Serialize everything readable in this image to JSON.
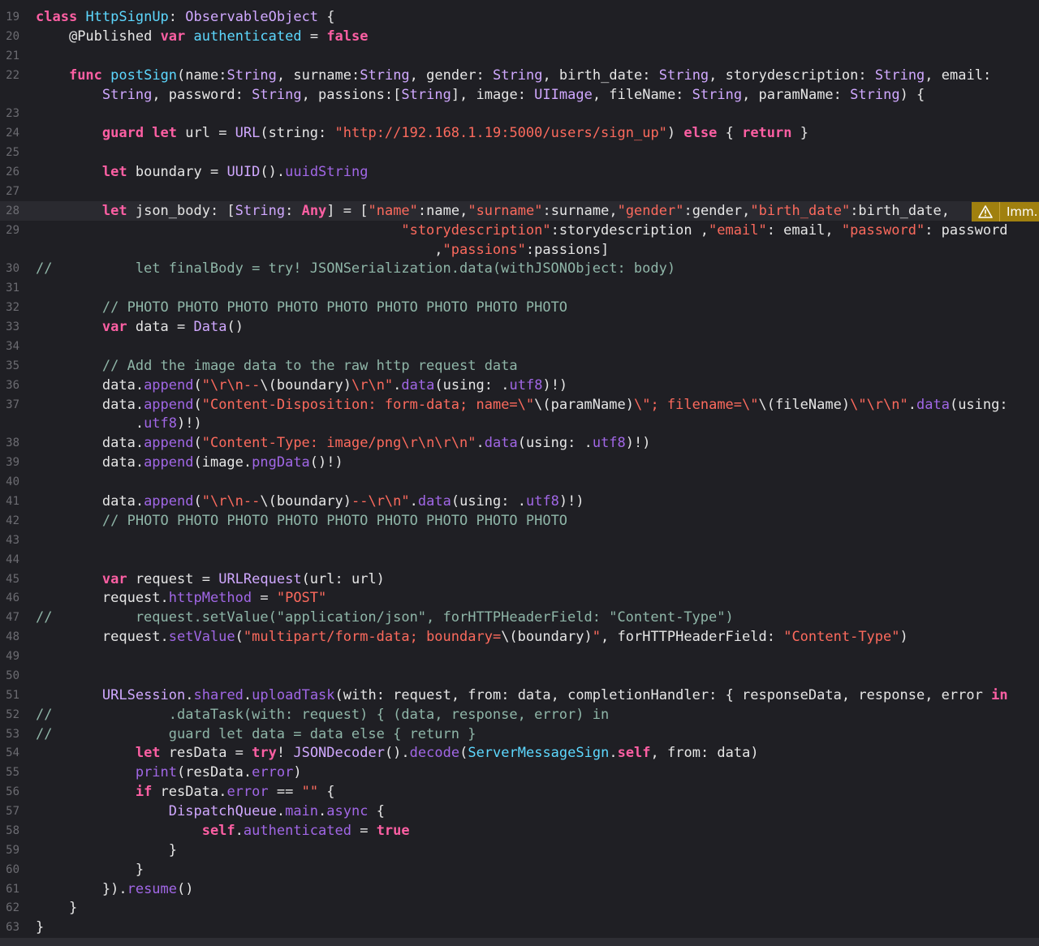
{
  "editor": {
    "warning_label": "Imm.",
    "warning_icon": "warning-triangle-icon",
    "lines": [
      {
        "n": "19",
        "html": "<span class=\"kw\">class</span> <span class=\"tn\">HttpSignUp</span>: <span class=\"ty\">ObservableObject</span> {"
      },
      {
        "n": "20",
        "html": "    <span class=\"pl\">@Published</span> <span class=\"kw\">var</span> <span class=\"tn\">authenticated</span> = <span class=\"kw\">false</span>"
      },
      {
        "n": "21",
        "html": ""
      },
      {
        "n": "22",
        "html": "    <span class=\"kw\">func</span> <span class=\"tn\">postSign</span>(name:<span class=\"ty\">String</span>, surname:<span class=\"ty\">String</span>, gender: <span class=\"ty\">String</span>, birth_date: <span class=\"ty\">String</span>, storydescription: <span class=\"ty\">String</span>, email:"
      },
      {
        "n": "",
        "html": "        <span class=\"ty\">String</span>, password: <span class=\"ty\">String</span>, passions:[<span class=\"ty\">String</span>], image: <span class=\"ty\">UIImage</span>, fileName: <span class=\"ty\">String</span>, paramName: <span class=\"ty\">String</span>) {"
      },
      {
        "n": "23",
        "html": ""
      },
      {
        "n": "24",
        "html": "        <span class=\"kw\">guard let</span> url = <span class=\"ty\">URL</span>(string: <span class=\"st\">\"http://192.168.1.19:5000/users/sign_up\"</span>) <span class=\"kw\">else</span> { <span class=\"kw\">return</span> }"
      },
      {
        "n": "25",
        "html": ""
      },
      {
        "n": "26",
        "html": "        <span class=\"kw\">let</span> boundary = <span class=\"ty\">UUID</span>().<span class=\"pr\">uuidString</span>"
      },
      {
        "n": "27",
        "html": ""
      },
      {
        "n": "28",
        "html": "        <span class=\"kw\">let</span> json_body: [<span class=\"ty\">String</span>: <span class=\"kw\">Any</span>] = [<span class=\"st\">\"name\"</span>:name,<span class=\"st\">\"surname\"</span>:surname,<span class=\"st\">\"gender\"</span>:gender,<span class=\"st\">\"birth_date\"</span>:birth_date,",
        "current": true
      },
      {
        "n": "29",
        "html": "                                            <span class=\"st\">\"storydescription\"</span>:storydescription ,<span class=\"st\">\"email\"</span>: email, <span class=\"st\">\"password\"</span>: password"
      },
      {
        "n": "",
        "html": "                                                ,<span class=\"st\">\"passions\"</span>:passions]"
      },
      {
        "n": "30",
        "html": "<span class=\"cm\">//          let finalBody = try! JSONSerialization.data(withJSONObject: body)</span>"
      },
      {
        "n": "31",
        "html": ""
      },
      {
        "n": "32",
        "html": "        <span class=\"cm\">// PHOTO PHOTO PHOTO PHOTO PHOTO PHOTO PHOTO PHOTO PHOTO</span>"
      },
      {
        "n": "33",
        "html": "        <span class=\"kw\">var</span> data = <span class=\"ty\">Data</span>()"
      },
      {
        "n": "34",
        "html": ""
      },
      {
        "n": "35",
        "html": "        <span class=\"cm\">// Add the image data to the raw http request data</span>"
      },
      {
        "n": "36",
        "html": "        data.<span class=\"pr\">append</span>(<span class=\"st\">\"\\r\\n--</span>\\(boundary)<span class=\"st\">\\r\\n\"</span>.<span class=\"pr\">data</span>(using: .<span class=\"pr\">utf8</span>)!)"
      },
      {
        "n": "37",
        "html": "        data.<span class=\"pr\">append</span>(<span class=\"st\">\"Content-Disposition: form-data; name=\\\"</span>\\(paramName)<span class=\"st\">\\\"; filename=\\\"</span>\\(fileName)<span class=\"st\">\\\"\\r\\n\"</span>.<span class=\"pr\">data</span>(using:"
      },
      {
        "n": "",
        "html": "            .<span class=\"pr\">utf8</span>)!)"
      },
      {
        "n": "38",
        "html": "        data.<span class=\"pr\">append</span>(<span class=\"st\">\"Content-Type: image/png\\r\\n\\r\\n\"</span>.<span class=\"pr\">data</span>(using: .<span class=\"pr\">utf8</span>)!)"
      },
      {
        "n": "39",
        "html": "        data.<span class=\"pr\">append</span>(image.<span class=\"pr\">pngData</span>()!)"
      },
      {
        "n": "40",
        "html": ""
      },
      {
        "n": "41",
        "html": "        data.<span class=\"pr\">append</span>(<span class=\"st\">\"\\r\\n--</span>\\(boundary)<span class=\"st\">--\\r\\n\"</span>.<span class=\"pr\">data</span>(using: .<span class=\"pr\">utf8</span>)!)"
      },
      {
        "n": "42",
        "html": "        <span class=\"cm\">// PHOTO PHOTO PHOTO PHOTO PHOTO PHOTO PHOTO PHOTO PHOTO</span>"
      },
      {
        "n": "43",
        "html": ""
      },
      {
        "n": "44",
        "html": ""
      },
      {
        "n": "45",
        "html": "        <span class=\"kw\">var</span> request = <span class=\"ty\">URLRequest</span>(url: url)"
      },
      {
        "n": "46",
        "html": "        request.<span class=\"pr\">httpMethod</span> = <span class=\"st\">\"POST\"</span>"
      },
      {
        "n": "47",
        "html": "<span class=\"cm\">//          request.setValue(\"application/json\", forHTTPHeaderField: \"Content-Type\")</span>"
      },
      {
        "n": "48",
        "html": "        request.<span class=\"pr\">setValue</span>(<span class=\"st\">\"multipart/form-data; boundary=</span>\\(boundary)<span class=\"st\">\"</span>, forHTTPHeaderField: <span class=\"st\">\"Content-Type\"</span>)"
      },
      {
        "n": "49",
        "html": ""
      },
      {
        "n": "50",
        "html": ""
      },
      {
        "n": "51",
        "html": "        <span class=\"ty\">URLSession</span>.<span class=\"pr\">shared</span>.<span class=\"pr\">uploadTask</span>(with: request, from: data, completionHandler: { responseData, response, error <span class=\"kw\">in</span>"
      },
      {
        "n": "52",
        "html": "<span class=\"cm\">//              .dataTask(with: request) { (data, response, error) in</span>"
      },
      {
        "n": "53",
        "html": "<span class=\"cm\">//              guard let data = data else { return }</span>"
      },
      {
        "n": "54",
        "html": "            <span class=\"kw\">let</span> resData = <span class=\"kw\">try</span>! <span class=\"ty\">JSONDecoder</span>().<span class=\"pr\">decode</span>(<span class=\"tn\">ServerMessageSign</span>.<span class=\"kw\">self</span>, from: data)"
      },
      {
        "n": "55",
        "html": "            <span class=\"pr\">print</span>(resData.<span class=\"pr\">error</span>)"
      },
      {
        "n": "56",
        "html": "            <span class=\"kw\">if</span> resData.<span class=\"pr\">error</span> == <span class=\"st\">\"\"</span> {"
      },
      {
        "n": "57",
        "html": "                <span class=\"ty\">DispatchQueue</span>.<span class=\"pr\">main</span>.<span class=\"pr\">async</span> {"
      },
      {
        "n": "58",
        "html": "                    <span class=\"kw\">self</span>.<span class=\"pr\">authenticated</span> = <span class=\"kw\">true</span>"
      },
      {
        "n": "59",
        "html": "                }"
      },
      {
        "n": "60",
        "html": "            }"
      },
      {
        "n": "61",
        "html": "        }).<span class=\"pr\">resume</span>()"
      },
      {
        "n": "62",
        "html": "    }"
      },
      {
        "n": "63",
        "html": "}"
      }
    ]
  }
}
